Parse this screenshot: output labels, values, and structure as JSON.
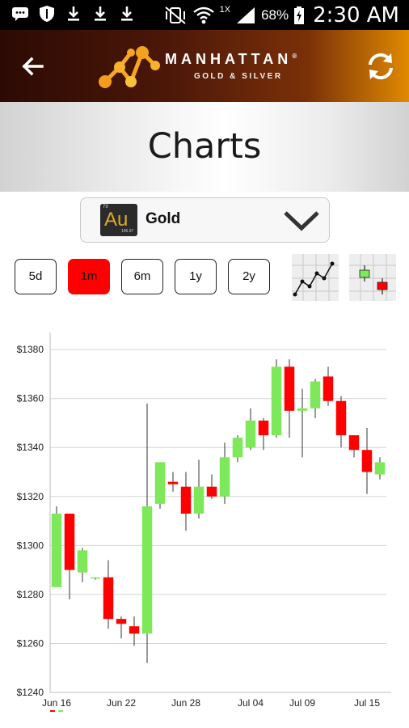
{
  "status_bar": {
    "network_type": "1X",
    "battery_percent": "68%",
    "time": "2:30 AM",
    "left_icons": [
      "message-icon",
      "shield-icon",
      "download-icon",
      "download-icon",
      "download-icon"
    ]
  },
  "app_bar": {
    "brand_name": "MANHATTAN",
    "brand_sub": "GOLD & SILVER",
    "registered": "®"
  },
  "page": {
    "title": "Charts"
  },
  "selector": {
    "symbol": "Au",
    "atomic_number": "79",
    "atomic_mass": "196.97",
    "selected_label": "Gold"
  },
  "ranges": [
    {
      "label": "5d",
      "active": false
    },
    {
      "label": "1m",
      "active": true
    },
    {
      "label": "6m",
      "active": false
    },
    {
      "label": "1y",
      "active": false
    },
    {
      "label": "2y",
      "active": false
    }
  ],
  "chart_types": [
    "line-chart-icon",
    "candlestick-chart-icon"
  ],
  "colors": {
    "up": "#7de85a",
    "down": "#ff0000",
    "active_range": "#ff0000"
  },
  "chart_data": {
    "type": "candlestick",
    "ylim": [
      1240,
      1385
    ],
    "y_ticks": [
      1240,
      1260,
      1280,
      1300,
      1320,
      1340,
      1360,
      1380
    ],
    "y_tick_labels": [
      "$1240",
      "$1260",
      "$1280",
      "$1300",
      "$1320",
      "$1340",
      "$1360",
      "$1380"
    ],
    "x_labels": [
      {
        "label": "Jun 16",
        "index": 0
      },
      {
        "label": "Jun 22",
        "index": 5
      },
      {
        "label": "Jun 28",
        "index": 10
      },
      {
        "label": "Jul 04",
        "index": 15
      },
      {
        "label": "Jul 09",
        "index": 19
      },
      {
        "label": "Jul 15",
        "index": 24
      }
    ],
    "candles": [
      {
        "open": 1283,
        "high": 1316,
        "low": 1283,
        "close": 1313
      },
      {
        "open": 1313,
        "high": 1313,
        "low": 1278,
        "close": 1290
      },
      {
        "open": 1289,
        "high": 1299,
        "low": 1285,
        "close": 1298
      },
      {
        "open": 1287,
        "high": 1287,
        "low": 1286,
        "close": 1287
      },
      {
        "open": 1287,
        "high": 1294,
        "low": 1266,
        "close": 1270
      },
      {
        "open": 1270,
        "high": 1271,
        "low": 1262,
        "close": 1268
      },
      {
        "open": 1267,
        "high": 1271,
        "low": 1259,
        "close": 1264
      },
      {
        "open": 1264,
        "high": 1358,
        "low": 1252,
        "close": 1316
      },
      {
        "open": 1317,
        "high": 1334,
        "low": 1315,
        "close": 1334
      },
      {
        "open": 1326,
        "high": 1330,
        "low": 1322,
        "close": 1325
      },
      {
        "open": 1324,
        "high": 1330,
        "low": 1306,
        "close": 1313
      },
      {
        "open": 1313,
        "high": 1335,
        "low": 1311,
        "close": 1324
      },
      {
        "open": 1324,
        "high": 1329,
        "low": 1319,
        "close": 1320
      },
      {
        "open": 1320,
        "high": 1342,
        "low": 1317,
        "close": 1336
      },
      {
        "open": 1336,
        "high": 1345,
        "low": 1334,
        "close": 1344
      },
      {
        "open": 1340,
        "high": 1356,
        "low": 1339,
        "close": 1351
      },
      {
        "open": 1351,
        "high": 1352,
        "low": 1339,
        "close": 1345
      },
      {
        "open": 1345,
        "high": 1376,
        "low": 1344,
        "close": 1373
      },
      {
        "open": 1373,
        "high": 1376,
        "low": 1344,
        "close": 1355
      },
      {
        "open": 1355,
        "high": 1364,
        "low": 1336,
        "close": 1356
      },
      {
        "open": 1356,
        "high": 1368,
        "low": 1352,
        "close": 1367
      },
      {
        "open": 1369,
        "high": 1373,
        "low": 1357,
        "close": 1359
      },
      {
        "open": 1359,
        "high": 1361,
        "low": 1340,
        "close": 1345
      },
      {
        "open": 1345,
        "high": 1345,
        "low": 1336,
        "close": 1339
      },
      {
        "open": 1339,
        "high": 1348,
        "low": 1321,
        "close": 1330
      },
      {
        "open": 1329,
        "high": 1336,
        "low": 1327,
        "close": 1334
      }
    ]
  }
}
